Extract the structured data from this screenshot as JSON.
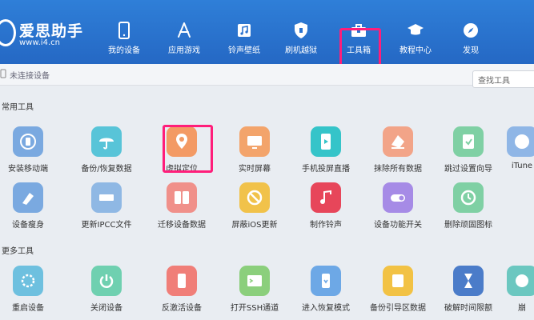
{
  "app": {
    "name": "爱思助手",
    "url": "www.i4.cn"
  },
  "nav": [
    {
      "id": "my-device",
      "label": "我的设备"
    },
    {
      "id": "apps-games",
      "label": "应用游戏"
    },
    {
      "id": "ringtones-wallpapers",
      "label": "铃声壁纸"
    },
    {
      "id": "flash-jailbreak",
      "label": "刷机越狱"
    },
    {
      "id": "toolbox",
      "label": "工具箱",
      "active": true
    },
    {
      "id": "tutorials",
      "label": "教程中心"
    },
    {
      "id": "discover",
      "label": "发现"
    }
  ],
  "status": {
    "device": "未连接设备"
  },
  "search": {
    "placeholder": "查找工具"
  },
  "sections": {
    "common": "常用工具",
    "more": "更多工具"
  },
  "common_tools": [
    {
      "label": "安装移动端",
      "color": "#7aa9e0",
      "icon": "phone-install-icon"
    },
    {
      "label": "备份/恢复数据",
      "color": "#58c4d8",
      "icon": "umbrella-icon"
    },
    {
      "label": "虚拟定位",
      "color": "#f39a64",
      "icon": "location-pin-icon"
    },
    {
      "label": "实时屏幕",
      "color": "#f3a46b",
      "icon": "screen-icon"
    },
    {
      "label": "手机投屏直播",
      "color": "#35c4c9",
      "icon": "play-screen-icon"
    },
    {
      "label": "抹除所有数据",
      "color": "#f2a488",
      "icon": "eraser-icon"
    },
    {
      "label": "跳过设置向导",
      "color": "#7fd0a4",
      "icon": "skip-guide-icon"
    },
    {
      "label": "iTune",
      "color": "#8fb6e6",
      "icon": "itunes-icon"
    }
  ],
  "second_row_tools": [
    {
      "label": "设备瘦身",
      "color": "#7aa9e0",
      "icon": "broom-icon"
    },
    {
      "label": "更新IPCC文件",
      "color": "#8fb8e4",
      "icon": "ipcc-icon"
    },
    {
      "label": "迁移设备数据",
      "color": "#f0908a",
      "icon": "migrate-icon"
    },
    {
      "label": "屏蔽iOS更新",
      "color": "#f1c24a",
      "icon": "block-update-icon"
    },
    {
      "label": "制作铃声",
      "color": "#e7465a",
      "icon": "music-note-icon"
    },
    {
      "label": "设备功能开关",
      "color": "#a68be6",
      "icon": "toggle-icon"
    },
    {
      "label": "删除顽固图标",
      "color": "#7fd0a4",
      "icon": "delete-icon"
    }
  ],
  "more_tools": [
    {
      "label": "重启设备",
      "color": "#6ec0df",
      "icon": "restart-icon"
    },
    {
      "label": "关闭设备",
      "color": "#6fd0b0",
      "icon": "power-icon"
    },
    {
      "label": "反激活设备",
      "color": "#f07e78",
      "icon": "deactivate-icon"
    },
    {
      "label": "打开SSH通道",
      "color": "#8bcf7c",
      "icon": "ssh-icon"
    },
    {
      "label": "进入恢复模式",
      "color": "#6da8e6",
      "icon": "recovery-icon"
    },
    {
      "label": "备份引导区数据",
      "color": "#f2c244",
      "icon": "backup-boot-icon"
    },
    {
      "label": "破解时间限额",
      "color": "#4b7cc9",
      "icon": "hourglass-icon"
    },
    {
      "label": "崩",
      "color": "#6bc7c0",
      "icon": "crash-icon"
    }
  ],
  "colors": {
    "header": "#2a72cf",
    "highlight": "#ff1e7a",
    "background": "#e9edf2"
  }
}
